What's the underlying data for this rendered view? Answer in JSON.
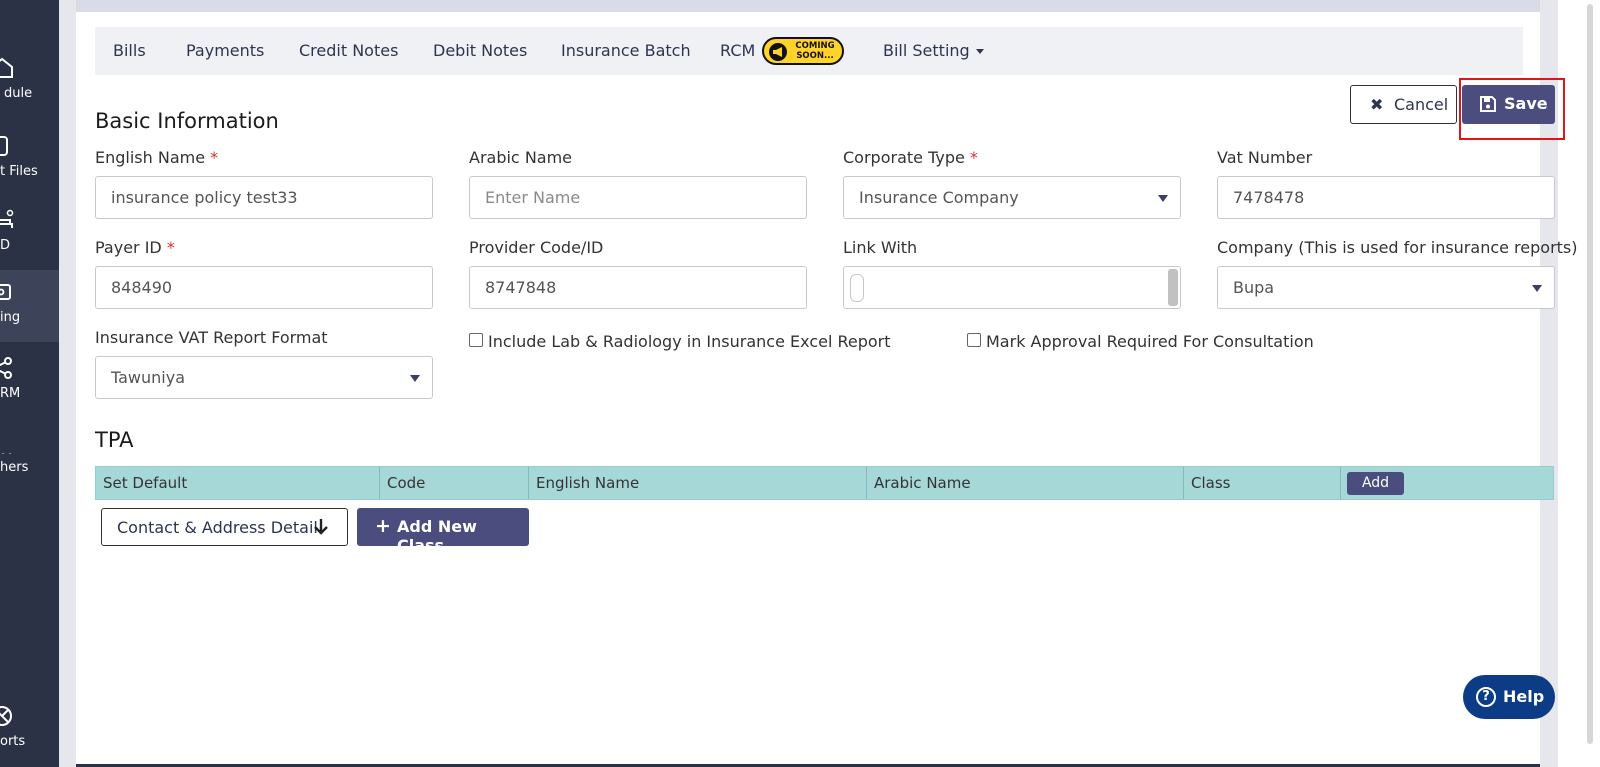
{
  "sidebar": {
    "items": [
      {
        "label": "dule",
        "icon": "home-icon"
      },
      {
        "label": "t Files",
        "icon": "files-icon"
      },
      {
        "label": "D",
        "icon": "bed-icon"
      },
      {
        "label": "ing",
        "icon": "billing-icon"
      },
      {
        "label": "RM",
        "icon": "network-icon"
      },
      {
        "label": "hers",
        "icon": "more-icon"
      },
      {
        "label": "orts",
        "icon": "reports-icon"
      }
    ]
  },
  "tabs": {
    "bills": "Bills",
    "payments": "Payments",
    "credit_notes": "Credit Notes",
    "debit_notes": "Debit Notes",
    "insurance_batch": "Insurance Batch",
    "rcm": "RCM",
    "rcm_badge_line1": "COMING",
    "rcm_badge_line2": "SOON...",
    "bill_setting": "Bill Setting"
  },
  "actions": {
    "cancel": "Cancel",
    "save": "Save"
  },
  "basic": {
    "title": "Basic Information",
    "english_name_label": "English Name",
    "english_name_value": "insurance policy test33",
    "arabic_name_label": "Arabic Name",
    "arabic_name_placeholder": "Enter Name",
    "corporate_type_label": "Corporate Type",
    "corporate_type_value": "Insurance Company",
    "vat_number_label": "Vat Number",
    "vat_number_value": "7478478",
    "payer_id_label": "Payer ID",
    "payer_id_value": "848490",
    "provider_code_label": "Provider Code/ID",
    "provider_code_value": "8747848",
    "link_with_label": "Link With",
    "company_label": "Company (This is used for insurance reports)",
    "company_value": "Bupa",
    "vat_report_label": "Insurance VAT Report Format",
    "vat_report_value": "Tawuniya",
    "include_lab_label": "Include Lab & Radiology in Insurance Excel Report",
    "mark_approval_label": "Mark Approval Required For Consultation",
    "required_mark": "*"
  },
  "tpa": {
    "title": "TPA",
    "columns": [
      "Set Default",
      "Code",
      "English Name",
      "Arabic Name",
      "Class"
    ],
    "add_button": "Add"
  },
  "footer_actions": {
    "contact_detail": "Contact & Address Detail",
    "add_new_class": "Add New Class",
    "help": "Help"
  },
  "colors": {
    "primary": "#4a4d7e",
    "sidebar": "#2c3245",
    "table_header": "#a7d8d8",
    "required": "#d9302c",
    "highlight": "#e0151b",
    "help": "#0d3c86",
    "badge": "#ffd32a"
  }
}
